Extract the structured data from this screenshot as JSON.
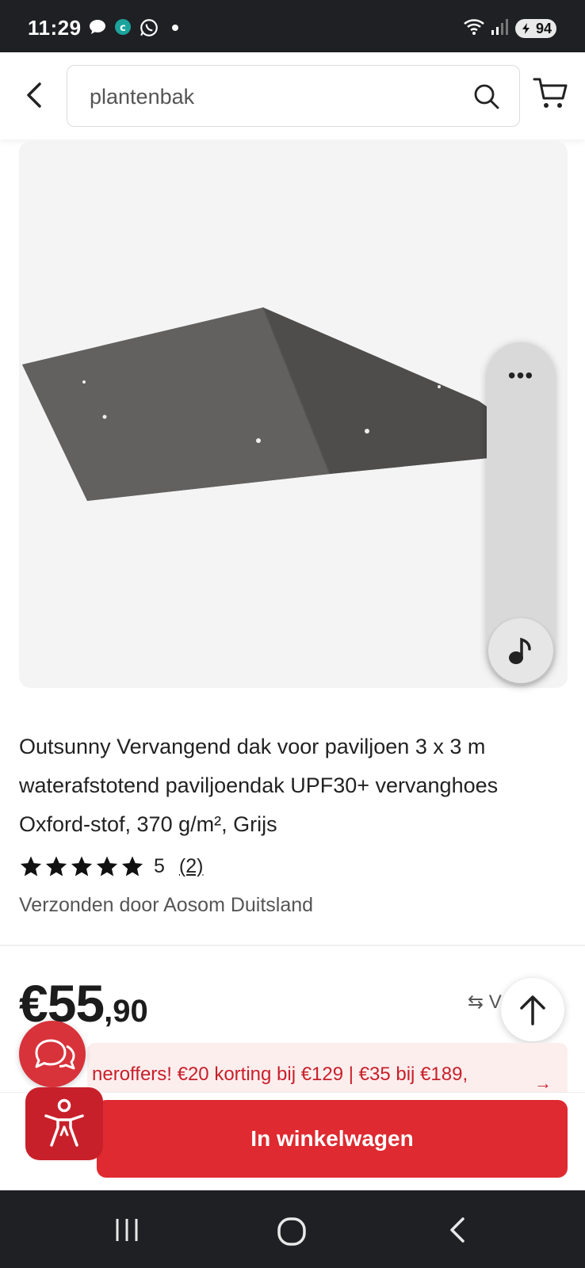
{
  "status_bar": {
    "time": "11:29",
    "battery": "94",
    "notification_icons": [
      "chat-bubble-icon",
      "app-c-icon",
      "whatsapp-icon"
    ],
    "system_icons": [
      "wifi-icon",
      "signal-icon",
      "battery-icon"
    ]
  },
  "header": {
    "search_value": "plantenbak",
    "back_icon": "chevron-left-icon",
    "search_icon": "search-icon",
    "cart_icon": "cart-icon"
  },
  "product": {
    "title": "Outsunny Vervangend dak voor paviljoen 3 x 3 m waterafstotend paviljoendak UPF30+ vervanghoes Oxford-stof, 370 g/m², Grijs",
    "rating_value": "5",
    "stars": 5,
    "review_count": "(2)",
    "shipped_by": "Verzonden door Aosom Duitsland",
    "price_main": "€55",
    "price_cents": ",90",
    "compare_label": "⇆ V"
  },
  "promo": {
    "text": "neroffers! €20 korting bij €129 | €35 bij €189,",
    "arrow": "→"
  },
  "side_panel": {
    "more_label": "•••",
    "music_icon": "music-note-icon"
  },
  "actions": {
    "add_to_cart_label": "In winkelwagen",
    "chat_icon": "chat-icon",
    "accessibility_icon": "accessibility-icon",
    "scroll_top_icon": "arrow-up-icon"
  },
  "nav_bar": {
    "items": [
      "recent-apps-icon",
      "home-icon",
      "back-icon"
    ]
  },
  "colors": {
    "accent": "#de2a30",
    "status_bar_bg": "#1f2023",
    "promo_bg": "#fdeeee",
    "roof_gray": "#5a5958"
  }
}
